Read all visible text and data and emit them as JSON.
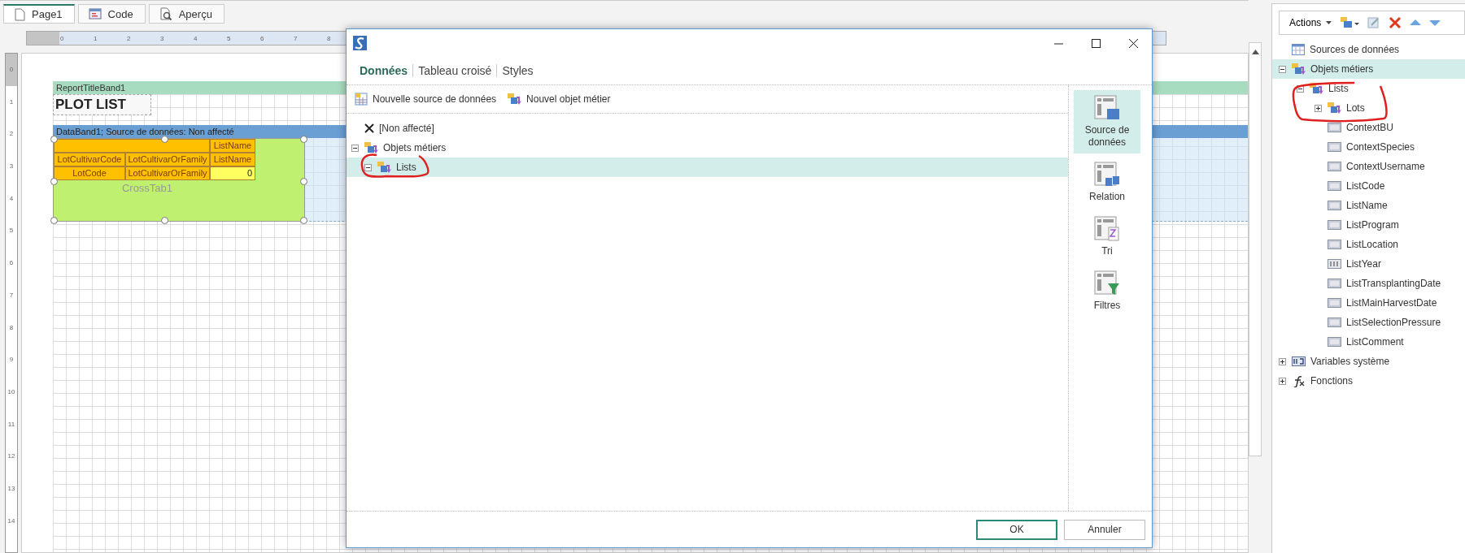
{
  "designer_tabs": [
    {
      "label": "Page1",
      "kind": "page",
      "selected": true
    },
    {
      "label": "Code",
      "kind": "code",
      "selected": false
    },
    {
      "label": "Aperçu",
      "kind": "preview",
      "selected": false
    }
  ],
  "rulers": {
    "horizontal": [
      "0",
      "1",
      "2",
      "3",
      "4",
      "5",
      "6",
      "7",
      "8"
    ],
    "vertical": [
      "0",
      "1",
      "2",
      "3",
      "4",
      "5",
      "6",
      "7",
      "8",
      "9",
      "10",
      "11",
      "12",
      "13",
      "14"
    ]
  },
  "report": {
    "title_band": "ReportTitleBand1",
    "title": "PLOT LIST",
    "data_band": "DataBand1; Source de données: Non affecté",
    "crosstab": {
      "name": "CrossTab1",
      "rows": [
        [
          {
            "kind": "corner",
            "text": ""
          },
          {
            "kind": "corner",
            "text": ""
          },
          {
            "kind": "header",
            "text": "ListName"
          }
        ],
        [
          {
            "kind": "header",
            "text": "LotCultivarCode"
          },
          {
            "kind": "header",
            "text": "LotCultivarOrFamily"
          },
          {
            "kind": "header",
            "text": "ListName"
          }
        ],
        [
          {
            "kind": "header",
            "text": "LotCode"
          },
          {
            "kind": "header",
            "text": "LotCultivarOrFamily"
          },
          {
            "kind": "value",
            "text": "0"
          }
        ]
      ]
    }
  },
  "dialog": {
    "tabs": [
      {
        "label": "Données",
        "selected": true
      },
      {
        "label": "Tableau croisé",
        "selected": false
      },
      {
        "label": "Styles",
        "selected": false
      }
    ],
    "toolbar": [
      {
        "label": "Nouvelle source de données",
        "kind": "datasource"
      },
      {
        "label": "Nouvel objet métier",
        "kind": "business"
      }
    ],
    "tree": [
      {
        "label": "[Non affecté]",
        "kind": "none",
        "selected": false
      },
      {
        "label": "Objets métiers",
        "kind": "business",
        "selected": false,
        "expanded": true,
        "children": [
          {
            "label": "Lists",
            "kind": "business",
            "selected": true,
            "expanded": true
          }
        ]
      }
    ],
    "side_buttons": [
      {
        "label": "Source de données",
        "kind": "datasource",
        "selected": true
      },
      {
        "label": "Relation",
        "kind": "relation",
        "selected": false
      },
      {
        "label": "Tri",
        "kind": "sort",
        "selected": false
      },
      {
        "label": "Filtres",
        "kind": "filter",
        "selected": false
      }
    ],
    "buttons": [
      {
        "label": "OK",
        "default": true
      },
      {
        "label": "Annuler",
        "default": false
      }
    ]
  },
  "dictionary": {
    "actions": "Actions",
    "tree": [
      {
        "label": "Sources de données",
        "kind": "datasource",
        "selected": false
      },
      {
        "label": "Objets métiers",
        "kind": "business",
        "selected": true,
        "expanded": true,
        "children": [
          {
            "label": "Lists",
            "kind": "business",
            "selected": false,
            "expanded": true,
            "children": [
              {
                "label": "Lots",
                "kind": "business",
                "selected": false,
                "expanded": false
              },
              {
                "label": "ContextBU",
                "kind": "string",
                "selected": false
              },
              {
                "label": "ContextSpecies",
                "kind": "string",
                "selected": false
              },
              {
                "label": "ContextUsername",
                "kind": "string",
                "selected": false
              },
              {
                "label": "ListCode",
                "kind": "string",
                "selected": false
              },
              {
                "label": "ListName",
                "kind": "string",
                "selected": false
              },
              {
                "label": "ListProgram",
                "kind": "string",
                "selected": false
              },
              {
                "label": "ListLocation",
                "kind": "string",
                "selected": false
              },
              {
                "label": "ListYear",
                "kind": "number",
                "selected": false
              },
              {
                "label": "ListTransplantingDate",
                "kind": "string",
                "selected": false
              },
              {
                "label": "ListMainHarvestDate",
                "kind": "string",
                "selected": false
              },
              {
                "label": "ListSelectionPressure",
                "kind": "string",
                "selected": false
              },
              {
                "label": "ListComment",
                "kind": "string",
                "selected": false
              }
            ]
          }
        ]
      },
      {
        "label": "Variables système",
        "kind": "variables",
        "selected": false,
        "expanded": false
      },
      {
        "label": "Fonctions",
        "kind": "functions",
        "selected": false,
        "expanded": false
      }
    ]
  }
}
